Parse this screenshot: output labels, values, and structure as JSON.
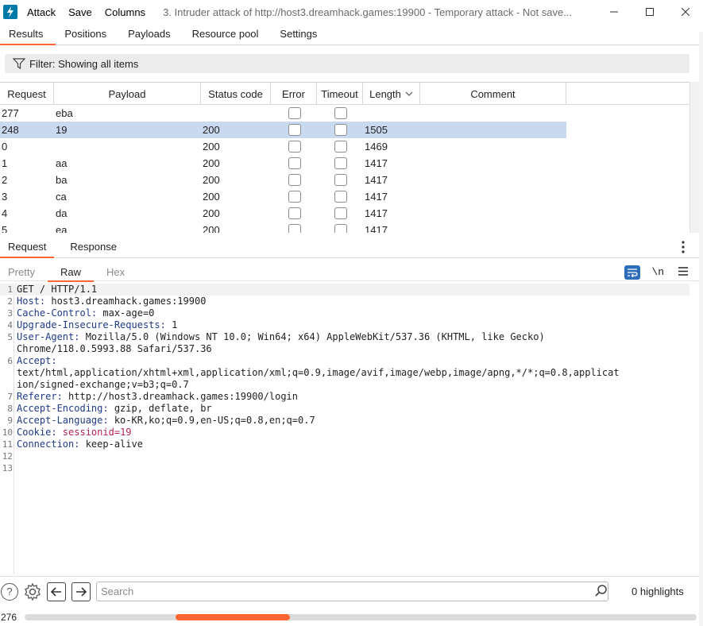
{
  "titlebar": {
    "menu": [
      "Attack",
      "Save",
      "Columns"
    ],
    "title": "3. Intruder attack of http://host3.dreamhack.games:19900 - Temporary attack - Not save..."
  },
  "tabs": [
    "Results",
    "Positions",
    "Payloads",
    "Resource pool",
    "Settings"
  ],
  "active_tab": "Results",
  "filter": {
    "label": "Filter: Showing all items"
  },
  "table": {
    "columns": [
      "Request",
      "Payload",
      "Status code",
      "Error",
      "Timeout",
      "Length",
      "Comment"
    ],
    "sort_column": "Length",
    "rows": [
      {
        "request": "277",
        "payload": "eba",
        "status": "",
        "length": ""
      },
      {
        "request": "248",
        "payload": "19",
        "status": "200",
        "length": "1505",
        "selected": true
      },
      {
        "request": "0",
        "payload": "",
        "status": "200",
        "length": "1469"
      },
      {
        "request": "1",
        "payload": "aa",
        "status": "200",
        "length": "1417"
      },
      {
        "request": "2",
        "payload": "ba",
        "status": "200",
        "length": "1417"
      },
      {
        "request": "3",
        "payload": "ca",
        "status": "200",
        "length": "1417"
      },
      {
        "request": "4",
        "payload": "da",
        "status": "200",
        "length": "1417"
      },
      {
        "request": "5",
        "payload": "ea",
        "status": "200",
        "length": "1417"
      }
    ]
  },
  "message_tabs": [
    "Request",
    "Response"
  ],
  "active_message_tab": "Request",
  "view_tabs": [
    "Pretty",
    "Raw",
    "Hex"
  ],
  "active_view_tab": "Raw",
  "editor_tools": {
    "newline_label": "\\n"
  },
  "request_lines": [
    {
      "n": "1",
      "parts": [
        {
          "t": "GET / HTTP/1.1",
          "c": "hv"
        }
      ]
    },
    {
      "n": "2",
      "parts": [
        {
          "t": "Host:",
          "c": "hk"
        },
        {
          "t": " host3.dreamhack.games:19900",
          "c": "hv"
        }
      ]
    },
    {
      "n": "3",
      "parts": [
        {
          "t": "Cache-Control:",
          "c": "hk"
        },
        {
          "t": " max-age=0",
          "c": "hv"
        }
      ]
    },
    {
      "n": "4",
      "parts": [
        {
          "t": "Upgrade-Insecure-Requests:",
          "c": "hk"
        },
        {
          "t": " 1",
          "c": "hv"
        }
      ]
    },
    {
      "n": "5",
      "parts": [
        {
          "t": "User-Agent:",
          "c": "hk"
        },
        {
          "t": " Mozilla/5.0 (Windows NT 10.0; Win64; x64) AppleWebKit/537.36 (KHTML, like Gecko)",
          "c": "hv"
        }
      ]
    },
    {
      "n": "",
      "parts": [
        {
          "t": "Chrome/118.0.5993.88 Safari/537.36",
          "c": "hv"
        }
      ]
    },
    {
      "n": "6",
      "parts": [
        {
          "t": "Accept:",
          "c": "hk"
        }
      ]
    },
    {
      "n": "",
      "parts": [
        {
          "t": "text/html,application/xhtml+xml,application/xml;q=0.9,image/avif,image/webp,image/apng,*/*;q=0.8,applicat",
          "c": "hv"
        }
      ]
    },
    {
      "n": "",
      "parts": [
        {
          "t": "ion/signed-exchange;v=b3;q=0.7",
          "c": "hv"
        }
      ]
    },
    {
      "n": "7",
      "parts": [
        {
          "t": "Referer:",
          "c": "hk"
        },
        {
          "t": " http://host3.dreamhack.games:19900/login",
          "c": "hv"
        }
      ]
    },
    {
      "n": "8",
      "parts": [
        {
          "t": "Accept-Encoding:",
          "c": "hk"
        },
        {
          "t": " gzip, deflate, br",
          "c": "hv"
        }
      ]
    },
    {
      "n": "9",
      "parts": [
        {
          "t": "Accept-Language:",
          "c": "hk"
        },
        {
          "t": " ko-KR,ko;q=0.9,en-US;q=0.8,en;q=0.7",
          "c": "hv"
        }
      ]
    },
    {
      "n": "10",
      "parts": [
        {
          "t": "Cookie:",
          "c": "hk"
        },
        {
          "t": " sessionid=",
          "c": "cv"
        },
        {
          "t": "19",
          "c": "cv"
        }
      ]
    },
    {
      "n": "11",
      "parts": [
        {
          "t": "Connection:",
          "c": "hk"
        },
        {
          "t": " keep-alive",
          "c": "hv"
        }
      ]
    },
    {
      "n": "12",
      "parts": []
    },
    {
      "n": "13",
      "parts": []
    }
  ],
  "search": {
    "placeholder": "Search",
    "highlights": "0 highlights"
  },
  "status": {
    "count": "276",
    "progress": 0.17
  }
}
